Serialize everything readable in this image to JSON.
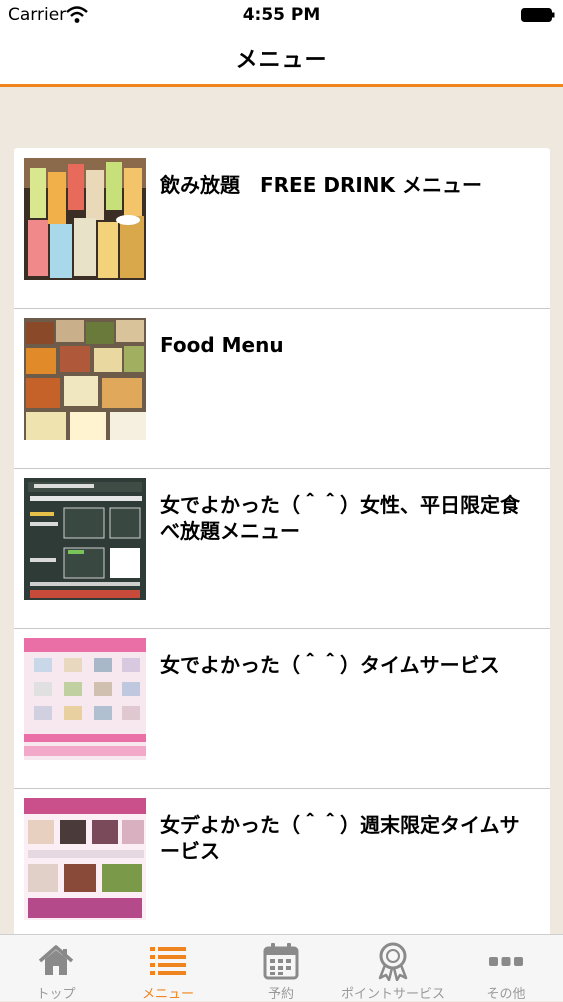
{
  "status": {
    "carrier": "Carrier",
    "time": "4:55 PM"
  },
  "nav": {
    "title": "メニュー"
  },
  "menu_items": [
    {
      "title": "飲み放題　FREE DRINK メニュー",
      "image": "drinks-photo"
    },
    {
      "title": "Food Menu",
      "image": "food-platter-photo"
    },
    {
      "title": "女でよかった（＾＾）女性、平日限定食べ放題メニュー",
      "image": "chalkboard-menu-photo"
    },
    {
      "title": "女でよかった（＾＾）タイムサービス",
      "image": "time-service-flyer"
    },
    {
      "title": "女デよかった（＾＾）週末限定タイムサービス",
      "image": "weekend-service-flyer"
    }
  ],
  "tabs": [
    {
      "label": "トップ",
      "icon": "home-icon",
      "active": false
    },
    {
      "label": "メニュー",
      "icon": "menu-list-icon",
      "active": true
    },
    {
      "label": "予約",
      "icon": "calendar-icon",
      "active": false
    },
    {
      "label": "ポイントサービス",
      "icon": "award-icon",
      "active": false
    },
    {
      "label": "その他",
      "icon": "more-icon",
      "active": false
    }
  ],
  "colors": {
    "accent": "#f0841e",
    "background": "#efe8df",
    "inactive_tab": "#9a9a9a"
  }
}
